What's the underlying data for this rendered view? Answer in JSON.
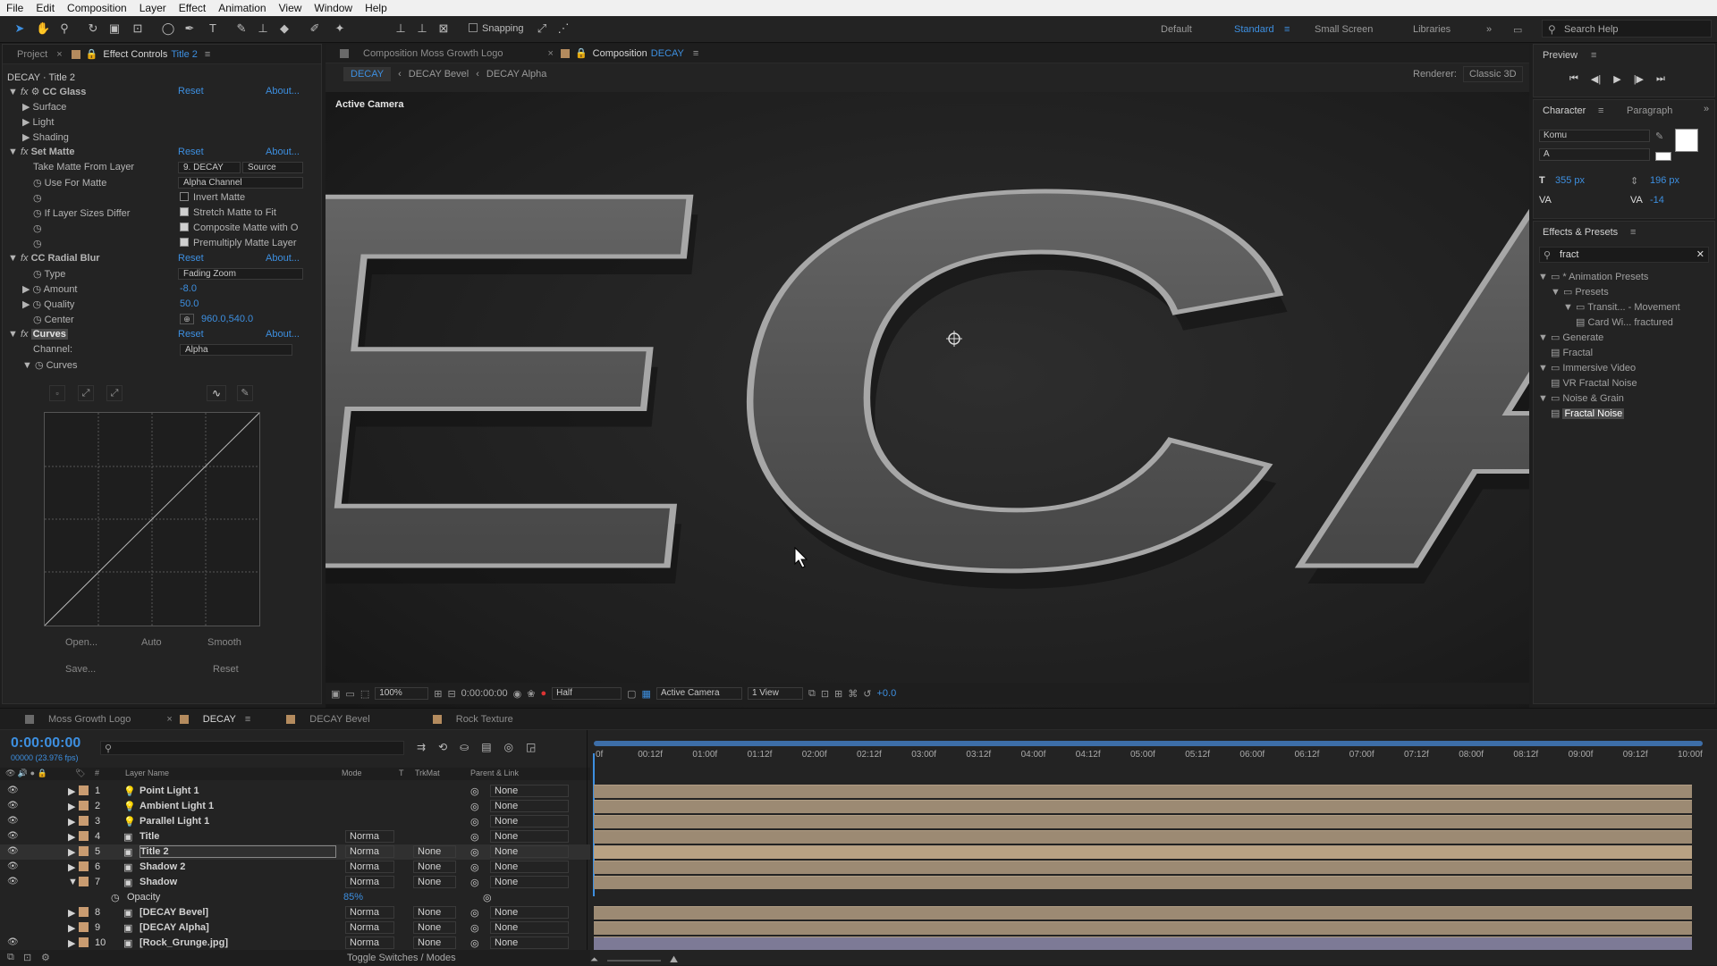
{
  "menu": [
    "File",
    "Edit",
    "Composition",
    "Layer",
    "Effect",
    "Animation",
    "View",
    "Window",
    "Help"
  ],
  "toolbar": {
    "snapping": "Snapping",
    "workspaces": [
      "Default",
      "Standard",
      "Small Screen",
      "Libraries"
    ],
    "active_ws": "Standard",
    "search": "Search Help"
  },
  "left_tabs": {
    "project": "Project",
    "effect_controls": "Effect Controls",
    "layer": "Title 2"
  },
  "ec": {
    "header": "DECAY · Title 2",
    "cc_glass": "CC Glass",
    "reset": "Reset",
    "about": "About...",
    "surface": "Surface",
    "light": "Light",
    "shading": "Shading",
    "set_matte": "Set Matte",
    "take_matte": "Take Matte From Layer",
    "take_matte_val": "9. DECAY",
    "source": "Source",
    "use_for_matte": "Use For Matte",
    "alpha_channel": "Alpha Channel",
    "invert": "Invert Matte",
    "if_sizes": "If Layer Sizes Differ",
    "stretch": "Stretch Matte to Fit",
    "composite": "Composite Matte with O",
    "premultiply": "Premultiply Matte Layer",
    "radial_blur": "CC Radial Blur",
    "type": "Type",
    "type_val": "Fading Zoom",
    "amount": "Amount",
    "amount_val": "-8.0",
    "quality": "Quality",
    "quality_val": "50.0",
    "center": "Center",
    "center_val": "960.0,540.0",
    "curves": "Curves",
    "channel": "Channel:",
    "channel_val": "Alpha",
    "curves_sub": "Curves",
    "open": "Open...",
    "auto": "Auto",
    "smooth": "Smooth",
    "save": "Save...",
    "reset2": "Reset"
  },
  "comp": {
    "tab1": "Composition Moss Growth Logo",
    "tab2": "Composition",
    "tab2_name": "DECAY",
    "crumbs": [
      "DECAY",
      "DECAY Bevel",
      "DECAY Alpha"
    ],
    "renderer_lbl": "Renderer:",
    "renderer": "Classic 3D",
    "active_camera": "Active Camera",
    "title_text": "DECAY",
    "zoom": "100%",
    "time": "0:00:00:00",
    "res": "Half",
    "view": "Active Camera",
    "views": "1 View",
    "exposure": "+0.0"
  },
  "right": {
    "preview": "Preview",
    "character": "Character",
    "paragraph": "Paragraph",
    "font": "Komu",
    "style": "A",
    "size": "355 px",
    "leading": "196 px",
    "tracking": "-14",
    "effects_presets": "Effects & Presets",
    "search": "fract"
  },
  "ep_items": [
    {
      "t": "* Animation Presets",
      "i": 0
    },
    {
      "t": "Presets",
      "i": 1
    },
    {
      "t": "Transit... - Movement",
      "i": 2
    },
    {
      "t": "Card Wi... fractured",
      "i": 3
    },
    {
      "t": "Generate",
      "i": 0
    },
    {
      "t": "Fractal",
      "i": 1
    },
    {
      "t": "Immersive Video",
      "i": 0
    },
    {
      "t": "VR Fractal Noise",
      "i": 1
    },
    {
      "t": "Noise & Grain",
      "i": 0
    },
    {
      "t": "Fractal Noise",
      "i": 1
    }
  ],
  "timeline": {
    "tabs": [
      "Moss Growth Logo",
      "DECAY",
      "DECAY Bevel",
      "Rock Texture"
    ],
    "active": "DECAY",
    "timecode": "0:00:00:00",
    "fps": "00000 (23.976 fps)",
    "cols": {
      "num": "#",
      "name": "Layer Name",
      "mode": "Mode",
      "t": "T",
      "trkmat": "TrkMat",
      "parent": "Parent & Link"
    },
    "ticks": [
      "0f",
      "00:12f",
      "01:00f",
      "01:12f",
      "02:00f",
      "02:12f",
      "03:00f",
      "03:12f",
      "04:00f",
      "04:12f",
      "05:00f",
      "05:12f",
      "06:00f",
      "06:12f",
      "07:00f",
      "07:12f",
      "08:00f",
      "08:12f",
      "09:00f",
      "09:12f",
      "10:00f"
    ],
    "toggle": "Toggle Switches / Modes",
    "layers": [
      {
        "n": "1",
        "name": "Point Light 1",
        "mode": "",
        "trk": "",
        "parent": "None"
      },
      {
        "n": "2",
        "name": "Ambient Light 1",
        "mode": "",
        "trk": "",
        "parent": "None"
      },
      {
        "n": "3",
        "name": "Parallel Light 1",
        "mode": "",
        "trk": "",
        "parent": "None"
      },
      {
        "n": "4",
        "name": "Title",
        "mode": "Norma",
        "trk": "",
        "parent": "None"
      },
      {
        "n": "5",
        "name": "Title 2",
        "mode": "Norma",
        "trk": "None",
        "parent": "None"
      },
      {
        "n": "6",
        "name": "Shadow 2",
        "mode": "Norma",
        "trk": "None",
        "parent": "None"
      },
      {
        "n": "7",
        "name": "Shadow",
        "mode": "Norma",
        "trk": "None",
        "parent": "None"
      },
      {
        "n": "",
        "name": "Opacity",
        "mode": "85%",
        "trk": "",
        "parent": ""
      },
      {
        "n": "8",
        "name": "[DECAY Bevel]",
        "mode": "Norma",
        "trk": "None",
        "parent": "None"
      },
      {
        "n": "9",
        "name": "[DECAY Alpha]",
        "mode": "Norma",
        "trk": "None",
        "parent": "None"
      },
      {
        "n": "10",
        "name": "[Rock_Grunge.jpg]",
        "mode": "Norma",
        "trk": "None",
        "parent": "None"
      }
    ]
  }
}
